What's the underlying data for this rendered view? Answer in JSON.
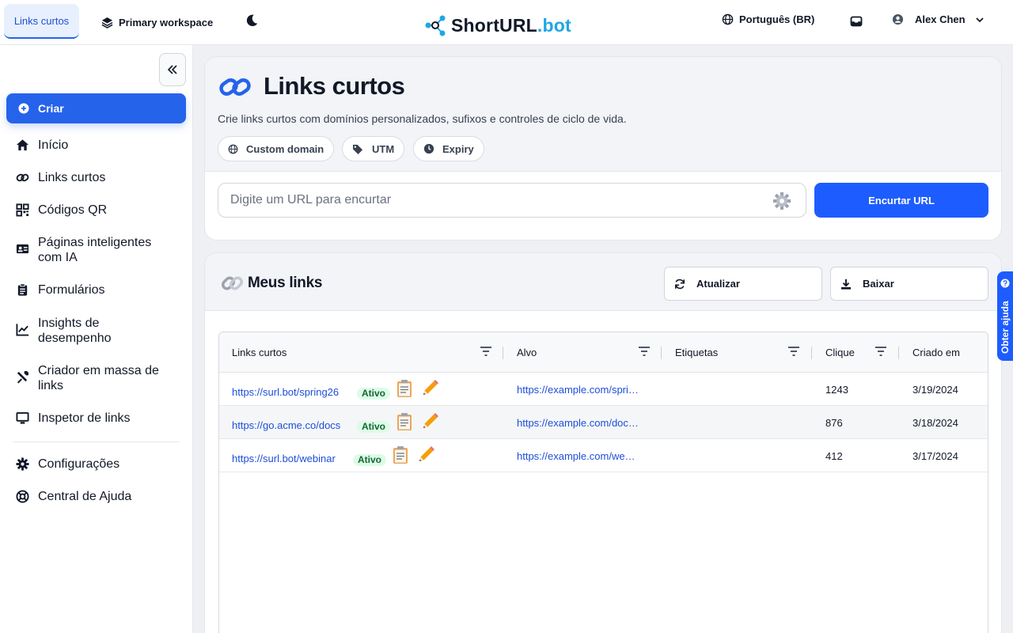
{
  "header": {
    "active_tab": "Links curtos",
    "workspace": "Primary workspace",
    "logo_main": "ShortURL",
    "logo_accent": ".bot",
    "language": "Português (BR)",
    "user_name": "Alex Chen"
  },
  "sidebar": {
    "create_label": "Criar",
    "items": [
      {
        "label": "Início",
        "icon": "home-icon"
      },
      {
        "label": "Links curtos",
        "icon": "link-icon"
      },
      {
        "label": "Códigos QR",
        "icon": "qr-icon"
      },
      {
        "label": "Páginas inteligentes com IA",
        "icon": "id-card-icon"
      },
      {
        "label": "Formulários",
        "icon": "clipboard-icon"
      },
      {
        "label": "Insights de desempenho",
        "icon": "chart-line-icon"
      },
      {
        "label": "Criador em massa de links",
        "icon": "tools-icon"
      },
      {
        "label": "Inspetor de links",
        "icon": "monitor-icon"
      }
    ],
    "bottom_items": [
      {
        "label": "Configurações",
        "icon": "gear-icon"
      },
      {
        "label": "Central de Ajuda",
        "icon": "lifebuoy-icon"
      }
    ]
  },
  "main": {
    "title": "Links curtos",
    "subtitle": "Crie links curtos com domínios personalizados, sufixos e controles de ciclo de vida.",
    "chips": [
      "Custom domain",
      "UTM",
      "Expiry"
    ],
    "url_placeholder": "Digite um URL para encurtar",
    "shorten_button": "Encurtar URL"
  },
  "links_panel": {
    "title": "Meus links",
    "refresh_button": "Atualizar",
    "download_button": "Baixar",
    "columns": [
      "Links curtos",
      "Alvo",
      "Etiquetas",
      "Clique",
      "Criado em"
    ],
    "rows": [
      {
        "short": "https://surl.bot/spring26",
        "status": "Ativo",
        "target": "https://example.com/spri…",
        "tags": "",
        "clicks": "1243",
        "created": "3/19/2024"
      },
      {
        "short": "https://go.acme.co/docs",
        "status": "Ativo",
        "target": "https://example.com/doc…",
        "tags": "",
        "clicks": "876",
        "created": "3/18/2024"
      },
      {
        "short": "https://surl.bot/webinar",
        "status": "Ativo",
        "target": "https://example.com/we…",
        "tags": "",
        "clicks": "412",
        "created": "3/17/2024"
      }
    ]
  },
  "help_tab": "Obter ajuda",
  "colors": {
    "primary": "#1d5cff",
    "accent": "#1ea7e4",
    "active_badge_bg": "#dcfce7"
  }
}
